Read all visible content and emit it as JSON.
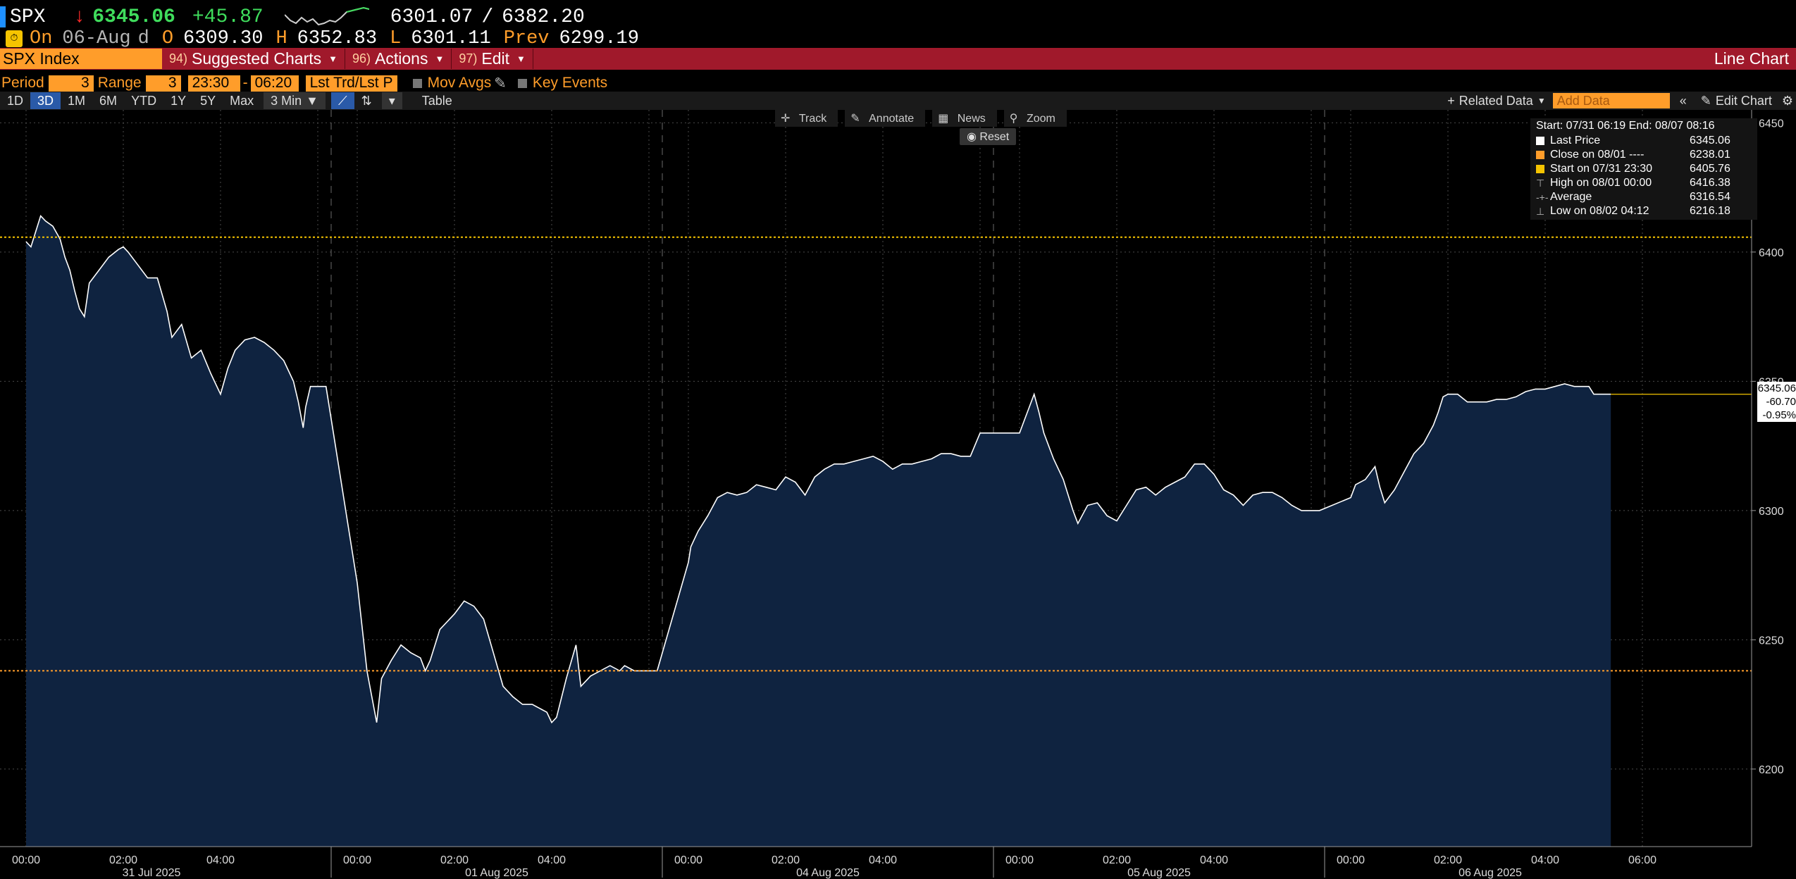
{
  "quote": {
    "ticker": "SPX",
    "arrow": "↓",
    "last": "6345.06",
    "change": "+45.87",
    "range_low": "6301.07",
    "range_sep": "/",
    "range_high": "6382.20",
    "on_label": "On",
    "date": "06-Aug",
    "d_label": "d",
    "open_label": "O",
    "open": "6309.30",
    "high_label": "H",
    "high": "6352.83",
    "low_label": "L",
    "low": "6301.11",
    "prev_label": "Prev",
    "prev": "6299.19"
  },
  "function_bar": {
    "security": "SPX Index",
    "menus": [
      {
        "num": "94)",
        "label": "Suggested Charts"
      },
      {
        "num": "96)",
        "label": "Actions"
      },
      {
        "num": "97)",
        "label": "Edit"
      }
    ],
    "chart_type": "Line Chart"
  },
  "params": {
    "period_label": "Period",
    "period_value": "3",
    "range_label": "Range",
    "range_value": "3",
    "time_start": "23:30",
    "time_end": "06:20",
    "lst_trd": "Lst Trd/Lst P",
    "mov_avgs": "Mov Avgs",
    "key_events": "Key Events"
  },
  "toolbar": {
    "periods": [
      "1D",
      "3D",
      "1M",
      "6M",
      "YTD",
      "1Y",
      "5Y",
      "Max"
    ],
    "selected": "3D",
    "interval": "3 Min",
    "table": "Table",
    "related": "Related Data",
    "add_data_placeholder": "Add Data",
    "edit_chart": "Edit Chart"
  },
  "tools": {
    "track": "Track",
    "annotate": "Annotate",
    "news": "News",
    "zoom": "Zoom",
    "reset": "Reset"
  },
  "legend": {
    "header": "Start: 07/31 06:19 End: 08/07 08:16",
    "rows": [
      {
        "label": "Last Price",
        "value": "6345.06",
        "color": "#ffffff",
        "glyph": "square"
      },
      {
        "label": "Close on 08/01 ----",
        "value": "6238.01",
        "color": "#ff9d2a",
        "glyph": "square"
      },
      {
        "label": "Start on 07/31 23:30",
        "value": "6405.76",
        "color": "#f5c400",
        "glyph": "square"
      },
      {
        "label": "High on 08/01 00:00",
        "value": "6416.38",
        "color": "#aaaaaa",
        "glyph": "⊤"
      },
      {
        "label": "Average",
        "value": "6316.54",
        "color": "#aaaaaa",
        "glyph": "-+-"
      },
      {
        "label": "Low on 08/02 04:12",
        "value": "6216.18",
        "color": "#aaaaaa",
        "glyph": "⊥"
      }
    ]
  },
  "price_tag": {
    "price": "6345.06",
    "change": "-60.70",
    "pct": "-0.95%"
  },
  "chart_data": {
    "type": "area",
    "title": "",
    "xlabel": "",
    "ylabel": "",
    "ylim": [
      6170,
      6455
    ],
    "yticks": [
      6200,
      6250,
      6300,
      6350,
      6400,
      6450
    ],
    "x_session_hours": [
      0,
      7
    ],
    "session_dates": [
      "31 Jul 2025",
      "01 Aug 2025",
      "04 Aug 2025",
      "05 Aug 2025",
      "06 Aug 2025"
    ],
    "time_ticks": [
      "00:00",
      "02:00",
      "04:00",
      "06:00"
    ],
    "reference_lines": [
      {
        "name": "Start",
        "value": 6405.76,
        "color": "#f5c400"
      },
      {
        "name": "Close on 08/01",
        "value": 6238.01,
        "color": "#ff9d2a"
      }
    ],
    "line_color": "#ffffff",
    "fill_color": "#0f2340",
    "grid": true,
    "series": [
      {
        "x": [
          [
            0,
            6404
          ],
          [
            0.1,
            6402
          ],
          [
            0.2,
            6408
          ],
          [
            0.3,
            6414
          ],
          [
            0.4,
            6412
          ],
          [
            0.55,
            6410
          ],
          [
            0.7,
            6405
          ],
          [
            0.8,
            6398
          ],
          [
            0.9,
            6393
          ],
          [
            1.0,
            6385
          ],
          [
            1.1,
            6378
          ],
          [
            1.2,
            6375
          ],
          [
            1.3,
            6388
          ],
          [
            1.5,
            6393
          ],
          [
            1.7,
            6398
          ],
          [
            1.9,
            6401
          ],
          [
            2.0,
            6402
          ],
          [
            2.1,
            6400
          ],
          [
            2.3,
            6395
          ],
          [
            2.5,
            6390
          ],
          [
            2.7,
            6390
          ],
          [
            2.9,
            6377
          ],
          [
            3.0,
            6367
          ],
          [
            3.2,
            6372
          ],
          [
            3.4,
            6359
          ],
          [
            3.6,
            6362
          ],
          [
            3.8,
            6353
          ],
          [
            4.0,
            6345
          ],
          [
            4.15,
            6355
          ],
          [
            4.3,
            6362
          ],
          [
            4.5,
            6366
          ],
          [
            4.7,
            6367
          ],
          [
            4.9,
            6365
          ],
          [
            5.1,
            6362
          ],
          [
            5.3,
            6358
          ],
          [
            5.5,
            6350
          ],
          [
            5.6,
            6342
          ],
          [
            5.7,
            6332
          ],
          [
            5.75,
            6340
          ],
          [
            5.85,
            6348
          ],
          [
            6.0,
            6348
          ],
          [
            6.17,
            6348
          ]
        ],
        "x2": [
          [
            0,
            6272
          ],
          [
            0.1,
            6255
          ],
          [
            0.2,
            6238
          ],
          [
            0.3,
            6228
          ],
          [
            0.4,
            6218
          ],
          [
            0.5,
            6235
          ],
          [
            0.7,
            6242
          ],
          [
            0.9,
            6248
          ],
          [
            1.1,
            6245
          ],
          [
            1.3,
            6243
          ],
          [
            1.4,
            6238
          ],
          [
            1.5,
            6242
          ],
          [
            1.7,
            6254
          ],
          [
            2.0,
            6260
          ],
          [
            2.2,
            6265
          ],
          [
            2.4,
            6263
          ],
          [
            2.6,
            6258
          ],
          [
            2.8,
            6245
          ],
          [
            3.0,
            6232
          ],
          [
            3.2,
            6228
          ],
          [
            3.4,
            6225
          ],
          [
            3.6,
            6225
          ],
          [
            3.8,
            6223
          ],
          [
            3.9,
            6222
          ],
          [
            4.0,
            6218
          ],
          [
            4.1,
            6220
          ],
          [
            4.3,
            6235
          ],
          [
            4.5,
            6248
          ],
          [
            4.6,
            6232
          ],
          [
            4.8,
            6236
          ],
          [
            5.0,
            6238
          ],
          [
            5.2,
            6240
          ],
          [
            5.4,
            6238
          ],
          [
            5.5,
            6240
          ],
          [
            5.7,
            6238
          ],
          [
            6.0,
            6238
          ],
          [
            6.17,
            6238
          ]
        ],
        "x3": [
          [
            0,
            6280
          ],
          [
            0.05,
            6286
          ],
          [
            0.2,
            6292
          ],
          [
            0.4,
            6298
          ],
          [
            0.6,
            6305
          ],
          [
            0.8,
            6307
          ],
          [
            1.0,
            6306
          ],
          [
            1.2,
            6307
          ],
          [
            1.4,
            6310
          ],
          [
            1.6,
            6309
          ],
          [
            1.8,
            6308
          ],
          [
            2.0,
            6313
          ],
          [
            2.2,
            6311
          ],
          [
            2.4,
            6306
          ],
          [
            2.6,
            6313
          ],
          [
            2.8,
            6316
          ],
          [
            3.0,
            6318
          ],
          [
            3.2,
            6318
          ],
          [
            3.4,
            6319
          ],
          [
            3.6,
            6320
          ],
          [
            3.8,
            6321
          ],
          [
            4.0,
            6319
          ],
          [
            4.2,
            6316
          ],
          [
            4.4,
            6318
          ],
          [
            4.6,
            6318
          ],
          [
            4.8,
            6319
          ],
          [
            5.0,
            6320
          ],
          [
            5.2,
            6322
          ],
          [
            5.4,
            6322
          ],
          [
            5.6,
            6321
          ],
          [
            5.8,
            6321
          ],
          [
            6.0,
            6330
          ],
          [
            6.17,
            6330
          ]
        ],
        "x4": [
          [
            0,
            6330
          ],
          [
            0.1,
            6335
          ],
          [
            0.2,
            6340
          ],
          [
            0.3,
            6345
          ],
          [
            0.4,
            6338
          ],
          [
            0.5,
            6330
          ],
          [
            0.7,
            6320
          ],
          [
            0.9,
            6312
          ],
          [
            1.1,
            6300
          ],
          [
            1.2,
            6295
          ],
          [
            1.4,
            6302
          ],
          [
            1.6,
            6303
          ],
          [
            1.8,
            6298
          ],
          [
            2.0,
            6296
          ],
          [
            2.2,
            6302
          ],
          [
            2.4,
            6308
          ],
          [
            2.6,
            6309
          ],
          [
            2.8,
            6306
          ],
          [
            3.0,
            6309
          ],
          [
            3.2,
            6311
          ],
          [
            3.4,
            6313
          ],
          [
            3.6,
            6318
          ],
          [
            3.8,
            6318
          ],
          [
            4.0,
            6314
          ],
          [
            4.2,
            6308
          ],
          [
            4.4,
            6306
          ],
          [
            4.6,
            6302
          ],
          [
            4.8,
            6306
          ],
          [
            5.0,
            6307
          ],
          [
            5.2,
            6307
          ],
          [
            5.4,
            6305
          ],
          [
            5.6,
            6302
          ],
          [
            5.8,
            6300
          ],
          [
            6.0,
            6300
          ],
          [
            6.17,
            6300
          ]
        ],
        "x5": [
          [
            0,
            6305
          ],
          [
            0.1,
            6310
          ],
          [
            0.3,
            6312
          ],
          [
            0.5,
            6317
          ],
          [
            0.6,
            6309
          ],
          [
            0.7,
            6303
          ],
          [
            0.9,
            6308
          ],
          [
            1.1,
            6315
          ],
          [
            1.3,
            6322
          ],
          [
            1.5,
            6326
          ],
          [
            1.7,
            6333
          ],
          [
            1.8,
            6338
          ],
          [
            1.9,
            6344
          ],
          [
            2.0,
            6345
          ],
          [
            2.2,
            6345
          ],
          [
            2.4,
            6342
          ],
          [
            2.6,
            6342
          ],
          [
            2.8,
            6342
          ],
          [
            3.0,
            6343
          ],
          [
            3.2,
            6343
          ],
          [
            3.4,
            6344
          ],
          [
            3.6,
            6346
          ],
          [
            3.8,
            6347
          ],
          [
            4.0,
            6347
          ],
          [
            4.2,
            6348
          ],
          [
            4.4,
            6349
          ],
          [
            4.6,
            6348
          ],
          [
            4.8,
            6348
          ],
          [
            4.9,
            6348
          ],
          [
            5.0,
            6345
          ],
          [
            5.1,
            6345
          ],
          [
            5.2,
            6345
          ],
          [
            5.3,
            6345
          ],
          [
            5.35,
            6345
          ]
        ]
      }
    ]
  }
}
